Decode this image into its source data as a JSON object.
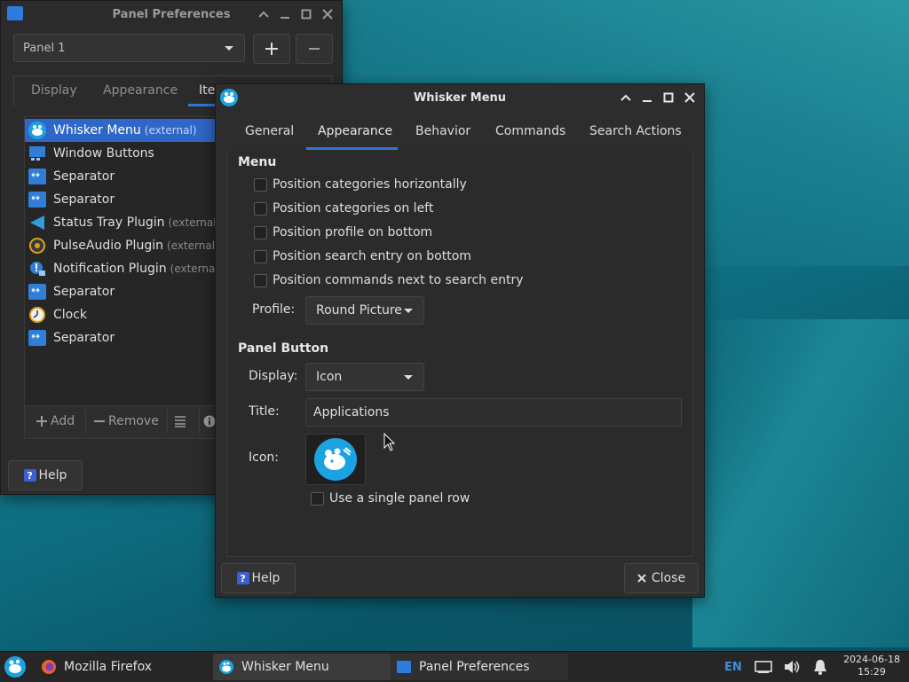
{
  "panel_prefs": {
    "title": "Panel Preferences",
    "panel_select": "Panel 1",
    "tabs": [
      "Display",
      "Appearance",
      "Ite"
    ],
    "items": [
      {
        "label": "Whisker Menu",
        "ext": "(external)",
        "icon": "whisker-icon",
        "selected": true
      },
      {
        "label": "Window Buttons",
        "ext": "",
        "icon": "window-buttons-icon"
      },
      {
        "label": "Separator",
        "ext": "",
        "icon": "separator-icon"
      },
      {
        "label": "Separator",
        "ext": "",
        "icon": "separator-icon"
      },
      {
        "label": "Status Tray Plugin",
        "ext": "(external)",
        "icon": "status-tray-icon"
      },
      {
        "label": "PulseAudio Plugin",
        "ext": "(external)",
        "icon": "pulseaudio-icon"
      },
      {
        "label": "Notification Plugin",
        "ext": "(external)",
        "icon": "notification-icon"
      },
      {
        "label": "Separator",
        "ext": "",
        "icon": "separator-icon"
      },
      {
        "label": "Clock",
        "ext": "",
        "icon": "clock-icon"
      },
      {
        "label": "Separator",
        "ext": "",
        "icon": "separator-icon"
      }
    ],
    "add_label": "Add",
    "remove_label": "Remove",
    "help_label": "Help"
  },
  "whisker": {
    "title": "Whisker Menu",
    "tabs": [
      "General",
      "Appearance",
      "Behavior",
      "Commands",
      "Search Actions"
    ],
    "active_tab": "Appearance",
    "menu_heading": "Menu",
    "menu_options": [
      "Position categories horizontally",
      "Position categories on left",
      "Position profile on bottom",
      "Position search entry on bottom",
      "Position commands next to search entry"
    ],
    "profile_label": "Profile:",
    "profile_value": "Round Picture",
    "panel_button_heading": "Panel Button",
    "display_label": "Display:",
    "display_value": "Icon",
    "title_label": "Title:",
    "title_value": "Applications",
    "icon_label": "Icon:",
    "single_row_label": "Use a single panel row",
    "help_label": "Help",
    "close_label": "Close"
  },
  "taskbar": {
    "tasks": [
      {
        "label": "Mozilla Firefox",
        "icon": "firefox-icon"
      },
      {
        "label": "Whisker Menu",
        "icon": "whisker-icon",
        "active": true
      },
      {
        "label": "Panel Preferences",
        "icon": "panel-prefs-icon"
      }
    ],
    "lang": "EN",
    "date": "2024-06-18",
    "time": "15:29"
  },
  "colors": {
    "accent": "#2f67c8",
    "whisker_blue": "#1aa3e0"
  }
}
